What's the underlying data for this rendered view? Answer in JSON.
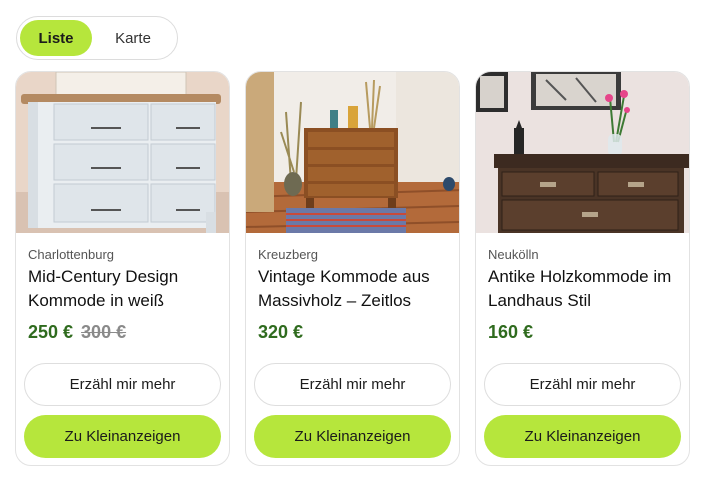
{
  "view_toggle": {
    "list_label": "Liste",
    "map_label": "Karte",
    "selected": "Liste"
  },
  "colors": {
    "accent": "#b6e63c",
    "price": "#2f6b1e",
    "old_price": "#8a8a8a"
  },
  "listings": [
    {
      "district": "Charlottenburg",
      "title": "Mid-Century Design Kommode in weiß",
      "price": "250 €",
      "old_price": "300 €",
      "image": "white-dresser-photo",
      "more_label": "Erzähl mir mehr",
      "go_label": "Zu Kleinanzeigen"
    },
    {
      "district": "Kreuzberg",
      "title": "Vintage Kommode aus Massivholz – Zeitlos",
      "price": "320 €",
      "old_price": "",
      "image": "wooden-chest-of-drawers-photo",
      "more_label": "Erzähl mir mehr",
      "go_label": "Zu Kleinanzeigen"
    },
    {
      "district": "Neukölln",
      "title": "Antike Holzkommode im Landhaus Stil",
      "price": "160 €",
      "old_price": "",
      "image": "antique-dresser-photo",
      "more_label": "Erzähl mir mehr",
      "go_label": "Zu Kleinanzeigen"
    }
  ]
}
